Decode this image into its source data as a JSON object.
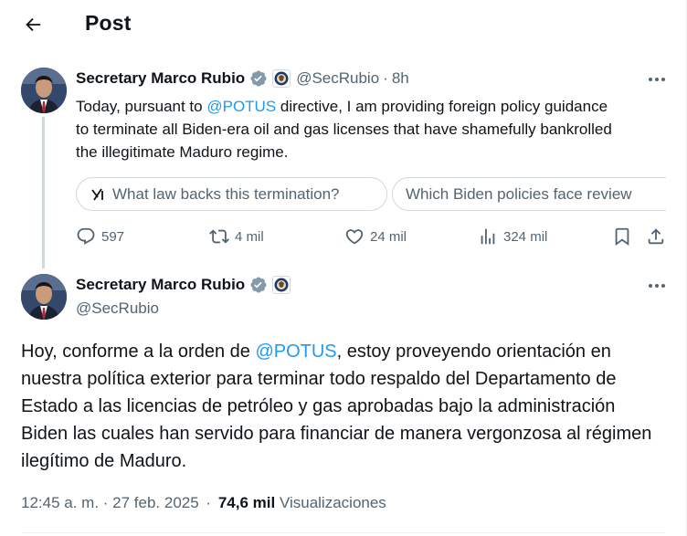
{
  "header": {
    "title": "Post"
  },
  "parent_tweet": {
    "display_name": "Secretary Marco Rubio",
    "handle": "@SecRubio",
    "separator": "·",
    "time": "8h",
    "text_before": "Today, pursuant to ",
    "mention": "@POTUS",
    "text_after": " directive, I am providing foreign policy guidance to terminate all Biden-era oil and gas licenses that have shamefully bankrolled the illegitimate Maduro regime.",
    "chips": [
      {
        "label": "What law backs this termination?",
        "icon": "grok-icon"
      },
      {
        "label": "Which Biden policies face review"
      }
    ],
    "actions": {
      "replies": "597",
      "reposts": "4 mil",
      "likes": "24 mil",
      "views": "324 mil"
    }
  },
  "main_tweet": {
    "display_name": "Secretary Marco Rubio",
    "handle": "@SecRubio",
    "text_before": "Hoy, conforme a la orden de ",
    "mention": "@POTUS",
    "text_after": ", estoy proveyendo orientación en nuestra política exterior para terminar todo respaldo del Departamento de Estado a las licencias de petróleo y gas aprobadas bajo la administración Biden las cuales han servido para financiar de manera vergonzosa al régimen ilegítimo de Maduro.",
    "timestamp": "12:45 a. m. · 27 feb. 2025",
    "meta_separator": "·",
    "views_count": "74,6 mil",
    "views_label": "Visualizaciones"
  },
  "colors": {
    "accent": "#1d9bf0",
    "verified": "#829aab",
    "muted": "#536471",
    "text": "#0f1419"
  }
}
